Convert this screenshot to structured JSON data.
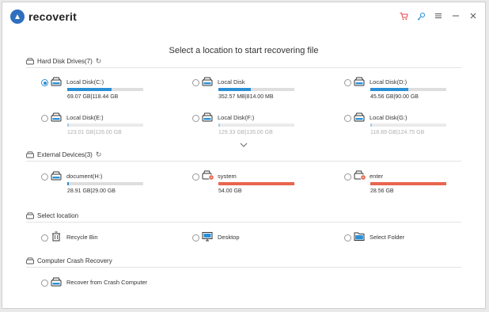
{
  "app": {
    "name": "recoverit"
  },
  "prompt": "Select a location to start recovering file",
  "sections": {
    "hard_disk": {
      "title": "Hard Disk Drives(7)",
      "items": [
        {
          "name": "Local Disk(C:)",
          "size": "69.07  GB|118.44  GB",
          "used_fraction": 0.58,
          "selected": true
        },
        {
          "name": "Local Disk",
          "size": "352.57  MB|814.00  MB",
          "used_fraction": 0.43
        },
        {
          "name": "Local Disk(D:)",
          "size": "45.56  GB|90.00  GB",
          "used_fraction": 0.5
        },
        {
          "name": "Local Disk(E:)",
          "size": "123.01  GB|126.00  GB",
          "used_fraction": 0.02
        },
        {
          "name": "Local Disk(F:)",
          "size": "129.33  GB|135.00  GB",
          "used_fraction": 0.02
        },
        {
          "name": "Local Disk(G:)",
          "size": "118.89  GB|124.75  GB",
          "used_fraction": 0.02
        }
      ]
    },
    "external": {
      "title": "External Devices(3)",
      "items": [
        {
          "name": "document(H:)",
          "size": "28.91  GB|29.00  GB",
          "used_fraction": 0.0
        },
        {
          "name": "system",
          "size": "54.00  GB",
          "used_fraction": 1.0,
          "color": "red"
        },
        {
          "name": "enter",
          "size": "28.56  GB",
          "used_fraction": 1.0,
          "color": "red"
        }
      ]
    },
    "select_location": {
      "title": "Select location",
      "items": [
        {
          "name": "Recycle Bin",
          "icon": "recycle-bin-icon"
        },
        {
          "name": "Desktop",
          "icon": "desktop-icon"
        },
        {
          "name": "Select Folder",
          "icon": "folder-icon"
        }
      ]
    },
    "crash": {
      "title": "Computer Crash Recovery",
      "items": [
        {
          "name": "Recover from Crash Computer",
          "icon": "drive-icon"
        }
      ]
    }
  },
  "colors": {
    "accent": "#2b8fd6",
    "warning": "#e8654f",
    "brand": "#2f6fbe",
    "cart": "#e8454a"
  }
}
